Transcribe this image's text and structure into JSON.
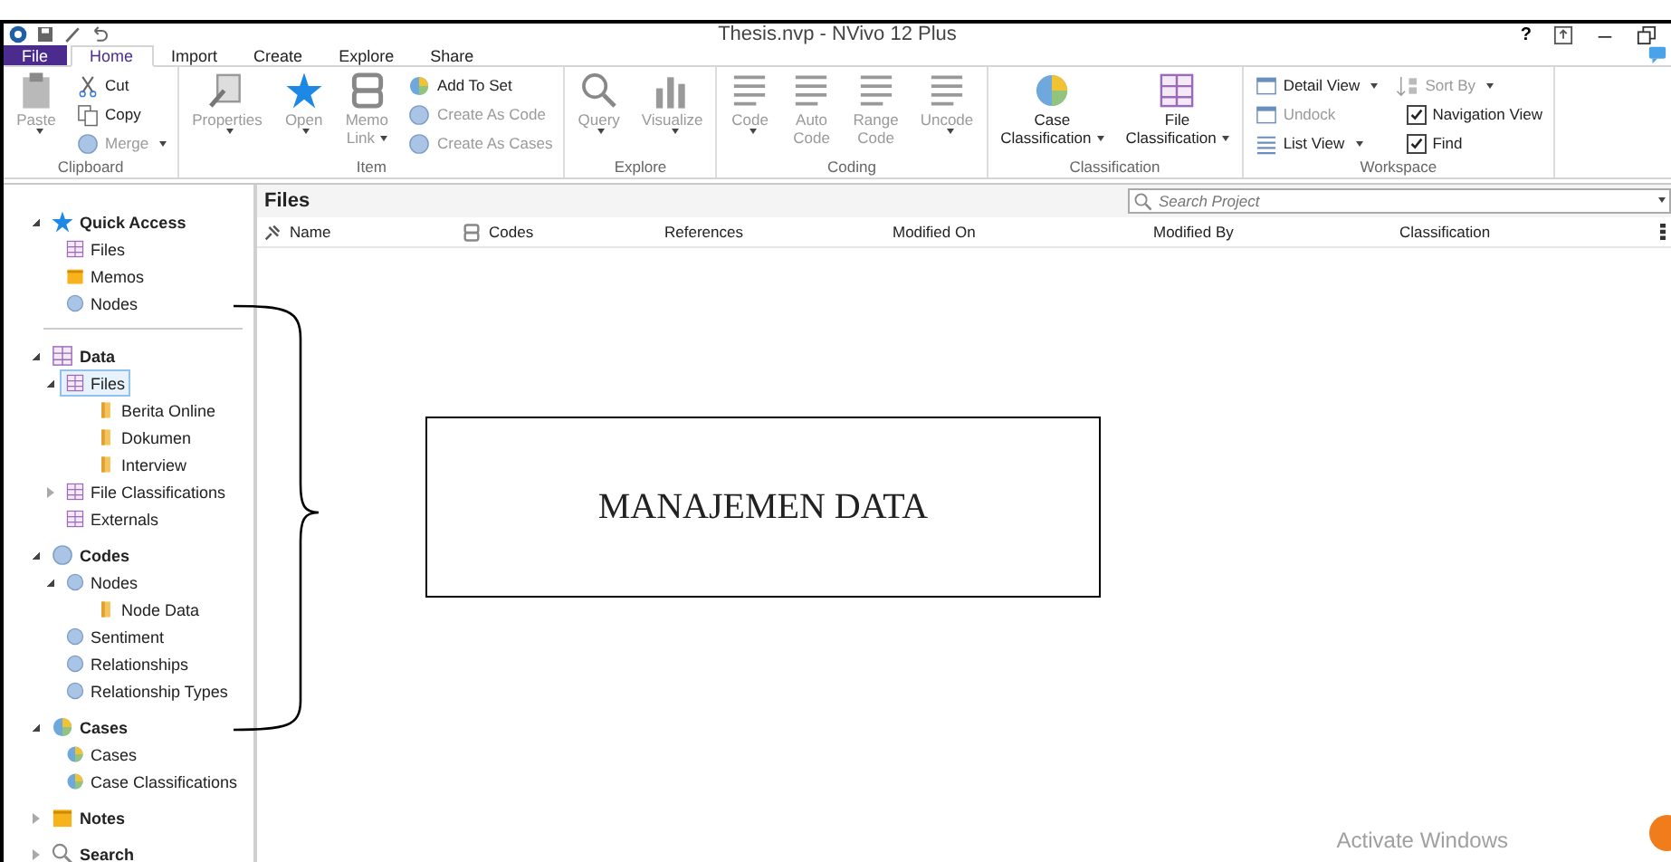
{
  "title_bar": {
    "title": "Thesis.nvp - NVivo 12 Plus",
    "help": "?"
  },
  "ribbon_tabs": [
    {
      "label": "File",
      "kind": "file",
      "selected": false
    },
    {
      "label": "Home",
      "kind": "tab",
      "selected": true
    },
    {
      "label": "Import",
      "kind": "tab",
      "selected": false
    },
    {
      "label": "Create",
      "kind": "tab",
      "selected": false
    },
    {
      "label": "Explore",
      "kind": "tab",
      "selected": false
    },
    {
      "label": "Share",
      "kind": "tab",
      "selected": false
    }
  ],
  "ribbon_groups": [
    {
      "label": "Clipboard",
      "columns": [
        [
          {
            "kind": "large",
            "lines": [
              "Paste"
            ],
            "dropdown": true,
            "disabled": true
          }
        ],
        [
          {
            "kind": "small",
            "label": "Cut",
            "disabled": false
          },
          {
            "kind": "small",
            "label": "Copy",
            "disabled": false
          },
          {
            "kind": "small",
            "label": "Merge",
            "dropdown": true,
            "disabled": true
          }
        ]
      ]
    },
    {
      "label": "Item",
      "columns": [
        [
          {
            "kind": "large",
            "lines": [
              "Properties"
            ],
            "dropdown": true,
            "disabled": true
          }
        ],
        [
          {
            "kind": "large",
            "lines": [
              "Open"
            ],
            "dropdown": true,
            "disabled": true
          }
        ],
        [
          {
            "kind": "large",
            "lines": [
              "Memo",
              "Link"
            ],
            "dropdown": true,
            "disabled": true
          }
        ],
        [
          {
            "kind": "small",
            "label": "Add To Set",
            "disabled": false
          },
          {
            "kind": "small",
            "label": "Create As Code",
            "disabled": true
          },
          {
            "kind": "small",
            "label": "Create As Cases",
            "disabled": true
          }
        ]
      ]
    },
    {
      "label": "Explore",
      "columns": [
        [
          {
            "kind": "large",
            "lines": [
              "Query"
            ],
            "dropdown": true,
            "disabled": true
          }
        ],
        [
          {
            "kind": "large",
            "lines": [
              "Visualize"
            ],
            "dropdown": true,
            "disabled": true
          }
        ]
      ]
    },
    {
      "label": "Coding",
      "columns": [
        [
          {
            "kind": "large",
            "lines": [
              "Code"
            ],
            "dropdown": true,
            "disabled": true
          }
        ],
        [
          {
            "kind": "large",
            "lines": [
              "Auto",
              "Code"
            ],
            "disabled": true
          }
        ],
        [
          {
            "kind": "large",
            "lines": [
              "Range",
              "Code"
            ],
            "disabled": true
          }
        ],
        [
          {
            "kind": "large",
            "lines": [
              "Uncode"
            ],
            "dropdown": true,
            "disabled": true
          }
        ]
      ]
    },
    {
      "label": "Classification",
      "columns": [
        [
          {
            "kind": "large",
            "lines": [
              "Case",
              "Classification"
            ],
            "dropdown": true,
            "disabled": false
          }
        ],
        [
          {
            "kind": "large",
            "lines": [
              "File",
              "Classification"
            ],
            "dropdown": true,
            "disabled": false
          }
        ]
      ]
    },
    {
      "label": "Workspace",
      "columns": [
        [
          {
            "kind": "small",
            "label": "Detail View",
            "dropdown": true,
            "disabled": false
          },
          {
            "kind": "small",
            "label": "Undock",
            "disabled": true
          },
          {
            "kind": "small",
            "label": "List View",
            "dropdown": true,
            "disabled": false
          }
        ],
        [
          {
            "kind": "small",
            "label": "Sort By",
            "dropdown": true,
            "disabled": true
          },
          {
            "kind": "check",
            "label": "Navigation View",
            "checked": true
          },
          {
            "kind": "check",
            "label": "Find",
            "checked": true
          }
        ]
      ]
    }
  ],
  "navigation": [
    {
      "title": "Quick Access",
      "expanded": true,
      "children": [
        {
          "label": "Files",
          "selected": false
        },
        {
          "label": "Memos",
          "selected": false
        },
        {
          "label": "Nodes",
          "selected": false
        }
      ]
    },
    {
      "title": "Data",
      "expanded": true,
      "children": [
        {
          "label": "Files",
          "selected": true,
          "expanded": true,
          "children": [
            {
              "label": "Berita Online",
              "selected": false
            },
            {
              "label": "Dokumen",
              "selected": false
            },
            {
              "label": "Interview",
              "selected": false
            }
          ]
        },
        {
          "label": "File Classifications",
          "selected": false,
          "expanded": false
        },
        {
          "label": "Externals",
          "selected": false
        }
      ]
    },
    {
      "title": "Codes",
      "expanded": true,
      "children": [
        {
          "label": "Nodes",
          "selected": false,
          "expanded": true,
          "children": [
            {
              "label": "Node Data",
              "selected": false
            }
          ]
        },
        {
          "label": "Sentiment",
          "selected": false
        },
        {
          "label": "Relationships",
          "selected": false
        },
        {
          "label": "Relationship Types",
          "selected": false
        }
      ]
    },
    {
      "title": "Cases",
      "expanded": true,
      "children": [
        {
          "label": "Cases",
          "selected": false
        },
        {
          "label": "Case Classifications",
          "selected": false
        }
      ]
    },
    {
      "title": "Notes",
      "expanded": false
    },
    {
      "title": "Search",
      "expanded": false
    }
  ],
  "panel": {
    "title": "Files",
    "search": {
      "placeholder": "Search Project"
    },
    "columns": [
      {
        "label": "Name"
      },
      {
        "label": "Codes"
      },
      {
        "label": "References"
      },
      {
        "label": "Modified On"
      },
      {
        "label": "Modified By"
      },
      {
        "label": "Classification"
      }
    ]
  },
  "annotation": {
    "label": "MANAJEMEN DATA"
  },
  "watermark": {
    "title": "Activate Windows"
  }
}
